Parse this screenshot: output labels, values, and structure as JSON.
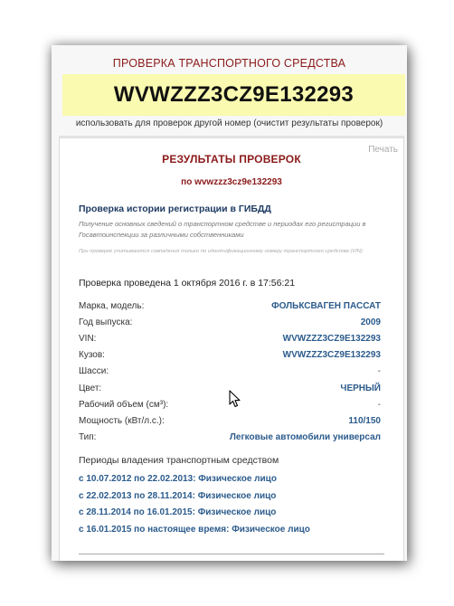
{
  "header": {
    "title": "ПРОВЕРКА ТРАНСПОРТНОГО СРЕДСТВА",
    "vin": "WVWZZZ3CZ9E132293",
    "use_other": "использовать для проверок другой номер (очистит результаты проверок)"
  },
  "panel": {
    "print_label": "Печать",
    "results_title": "РЕЗУЛЬТАТЫ ПРОВЕРОК",
    "results_sub": "по wvwzzz3cz9e132293",
    "section_title": "Проверка истории регистрации в ГИБДД",
    "description": "Получение основных сведений о транспортном средстве и периодах его регистрации в Госавтоинспекции за различными собственниками",
    "note": "При проверке учитываются совпадения только по идентификационному номеру транспортного средства (VIN)",
    "checked_at": "Проверка проведена 1 октября 2016 г. в 17:56:21",
    "rows": [
      {
        "label": "Марка, модель:",
        "value": "ФОЛЬКСВАГЕН ПАССАТ"
      },
      {
        "label": "Год выпуска:",
        "value": "2009"
      },
      {
        "label": "VIN:",
        "value": "WVWZZZ3CZ9E132293"
      },
      {
        "label": "Кузов:",
        "value": "WVWZZZ3CZ9E132293"
      },
      {
        "label": "Шасси:",
        "value": "-"
      },
      {
        "label": "Цвет:",
        "value": "ЧЕРНЫЙ"
      },
      {
        "label": "Рабочий объем (см³):",
        "value": "-"
      },
      {
        "label": "Мощность (кВт/л.с.):",
        "value": "110/150"
      },
      {
        "label": "Тип:",
        "value": "Легковые автомобили универсал"
      }
    ],
    "ownership_title": "Периоды владения транспортным средством",
    "ownership": [
      "с 10.07.2012 по 22.02.2013: Физическое лицо",
      "с 22.02.2013 по 28.11.2014: Физическое лицо",
      "с 28.11.2014 по 16.01.2015: Физическое лицо",
      "с 16.01.2015 по настоящее время: Физическое лицо"
    ]
  }
}
